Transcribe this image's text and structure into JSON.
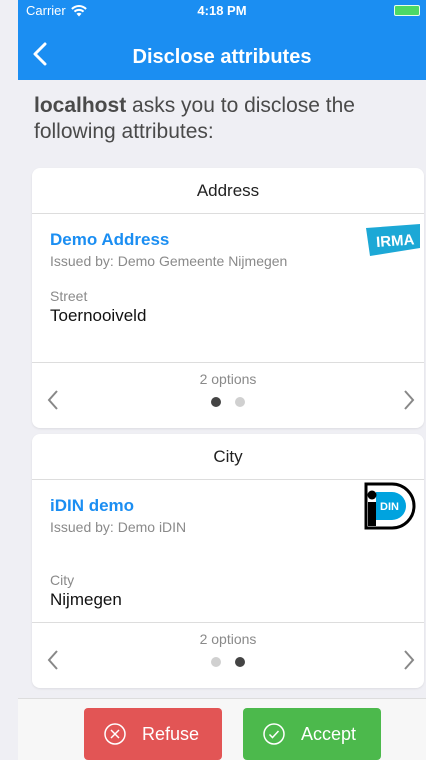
{
  "status_bar": {
    "carrier": "Carrier",
    "time": "4:18 PM"
  },
  "nav": {
    "title": "Disclose attributes",
    "back_icon": "chevron-left-icon"
  },
  "intro": {
    "host": "localhost",
    "text": " asks you to disclose the following attributes:"
  },
  "cards": [
    {
      "header": "Address",
      "credential_name": "Demo Address",
      "issuer": "Issued by: Demo Gemeente Nijmegen",
      "attribute_label": "Street",
      "attribute_value": "Toernooiveld",
      "logo": "IRMA",
      "options_label": "2 options",
      "active_option": 1,
      "option_count": 2
    },
    {
      "header": "City",
      "credential_name": "iDIN demo",
      "issuer": "Issued by: Demo iDIN",
      "attribute_label": "City",
      "attribute_value": "Nijmegen",
      "logo": "iDIN",
      "options_label": "2 options",
      "active_option": 2,
      "option_count": 2
    }
  ],
  "actions": {
    "refuse_label": "Refuse",
    "accept_label": "Accept"
  },
  "colors": {
    "primary": "#1b8ef2",
    "refuse": "#e25555",
    "accept": "#4cb94c",
    "irma": "#1ca8d6"
  }
}
